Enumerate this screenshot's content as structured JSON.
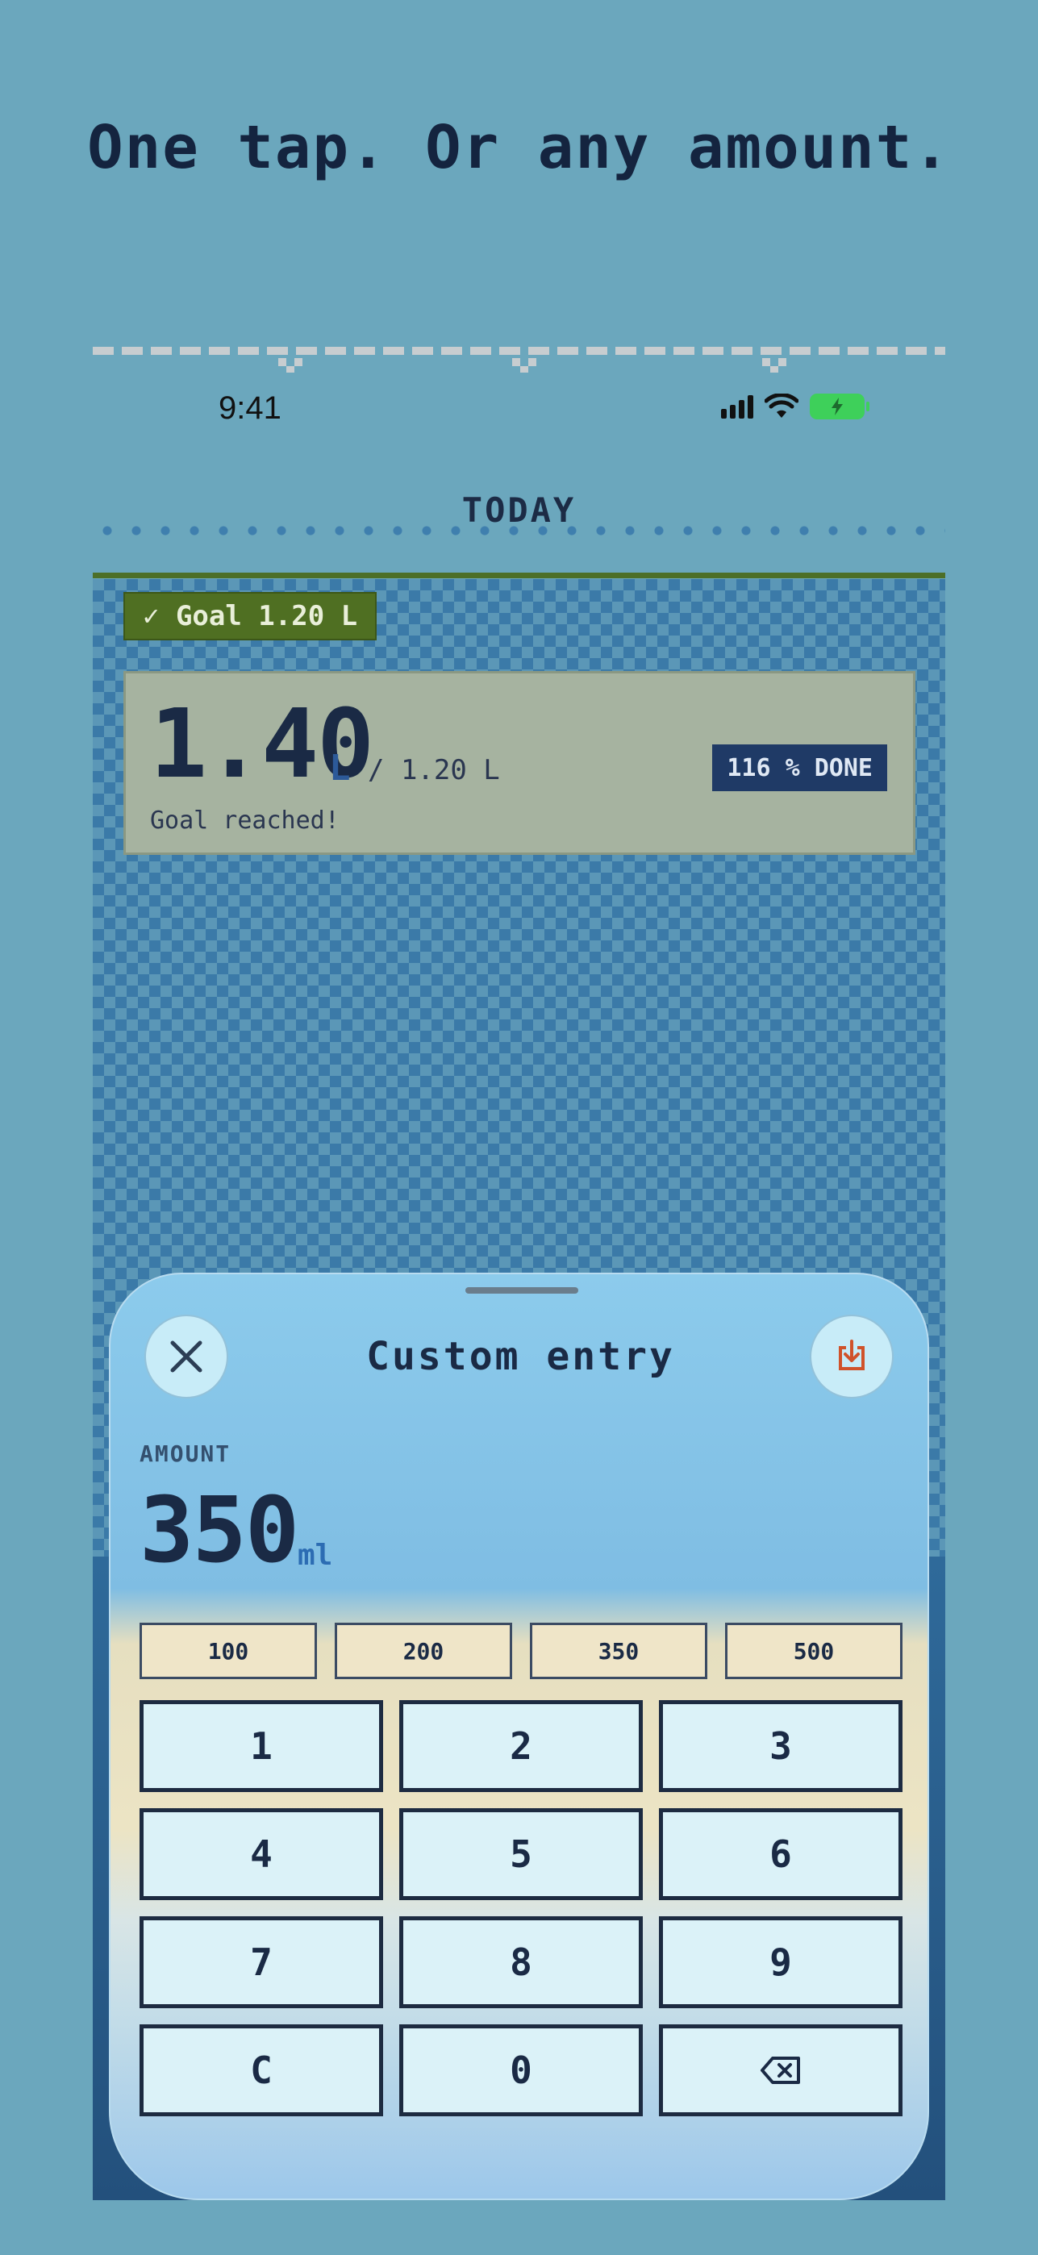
{
  "headline": "One tap. Or any amount.",
  "status": {
    "time": "9:41"
  },
  "screen_title": "TODAY",
  "goal_badge": "✓ Goal 1.20 L",
  "summary": {
    "total": "1.40",
    "unit": "L",
    "goal": "/ 1.20 L",
    "percent_badge": "116 % DONE",
    "status_text": "Goal reached!",
    "progress_percent": 116
  },
  "sheet": {
    "title": "Custom entry",
    "amount_label": "AMOUNT",
    "amount_value": "350",
    "amount_unit": "ml",
    "presets": [
      "100",
      "200",
      "350",
      "500"
    ],
    "keys": [
      "1",
      "2",
      "3",
      "4",
      "5",
      "6",
      "7",
      "8",
      "9",
      "C",
      "0"
    ]
  },
  "colors": {
    "background": "#6ba7bd",
    "goal_green": "#4f6f22",
    "done_badge": "#1f3a66",
    "battery": "#3ed05a",
    "save_icon": "#d0522a"
  },
  "icons": [
    "close-icon",
    "save-download-icon",
    "backspace-icon",
    "cellular-icon",
    "wifi-icon",
    "battery-charging-icon"
  ]
}
